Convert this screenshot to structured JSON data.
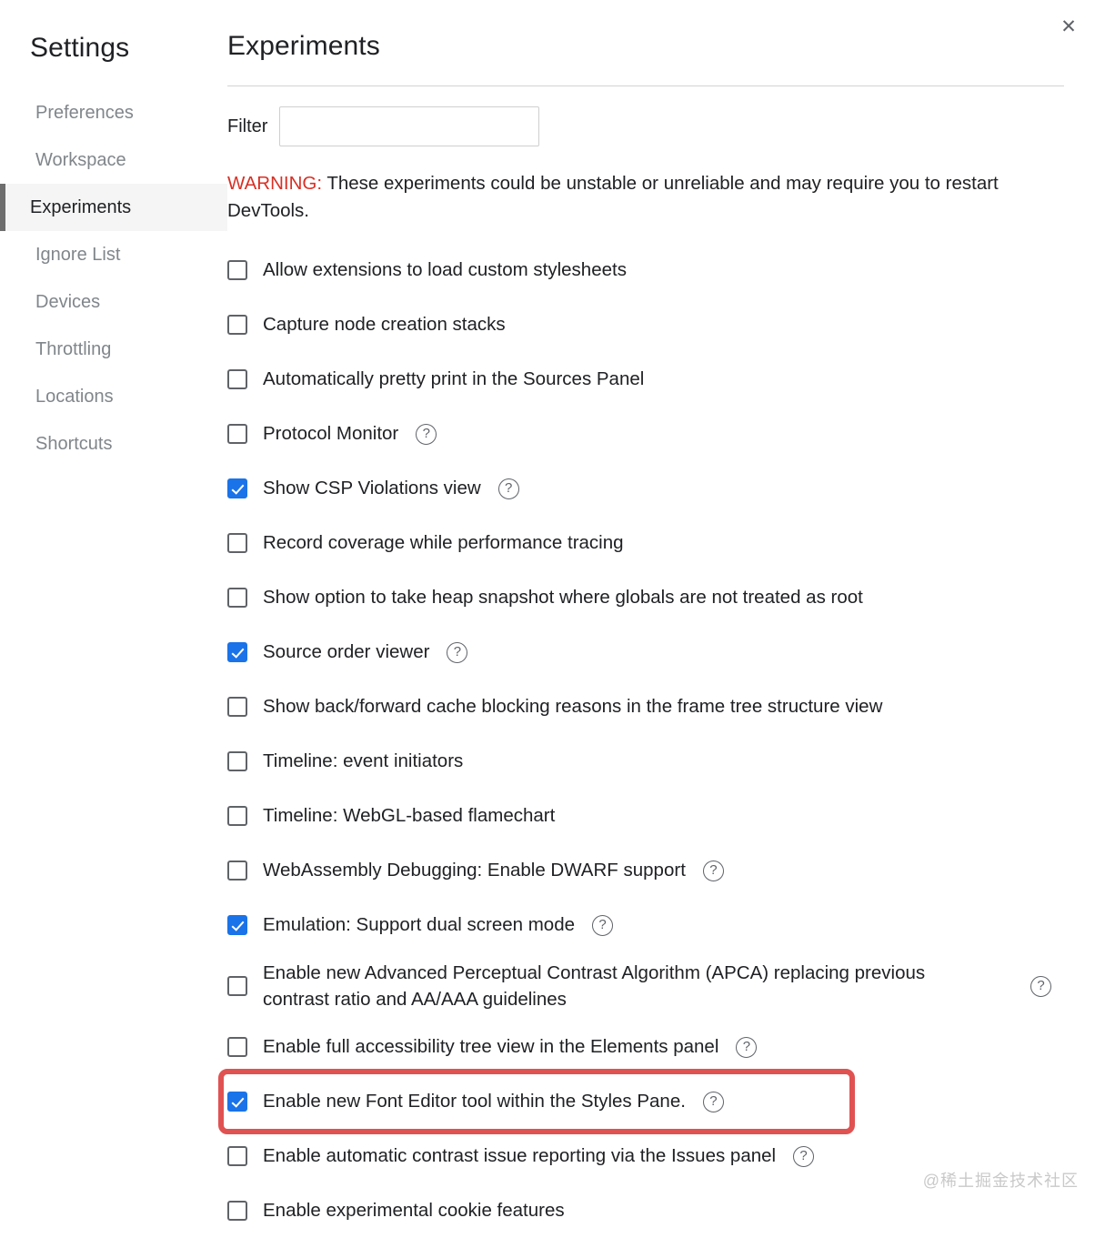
{
  "window": {
    "close_icon": "close-icon",
    "close_label": "✕"
  },
  "sidebar": {
    "title": "Settings",
    "items": [
      {
        "label": "Preferences",
        "selected": false
      },
      {
        "label": "Workspace",
        "selected": false
      },
      {
        "label": "Experiments",
        "selected": true
      },
      {
        "label": "Ignore List",
        "selected": false
      },
      {
        "label": "Devices",
        "selected": false
      },
      {
        "label": "Throttling",
        "selected": false
      },
      {
        "label": "Locations",
        "selected": false
      },
      {
        "label": "Shortcuts",
        "selected": false
      }
    ]
  },
  "main": {
    "title": "Experiments",
    "filter": {
      "label": "Filter",
      "value": "",
      "placeholder": ""
    },
    "warning": {
      "prefix": "WARNING:",
      "text": " These experiments could be unstable or unreliable and may require you to restart DevTools.",
      "prefix_color": "#d93025"
    },
    "experiments": [
      {
        "label": "Allow extensions to load custom stylesheets",
        "checked": false,
        "help": false,
        "help_far": false
      },
      {
        "label": "Capture node creation stacks",
        "checked": false,
        "help": false,
        "help_far": false
      },
      {
        "label": "Automatically pretty print in the Sources Panel",
        "checked": false,
        "help": false,
        "help_far": false
      },
      {
        "label": "Protocol Monitor",
        "checked": false,
        "help": true,
        "help_far": false
      },
      {
        "label": "Show CSP Violations view",
        "checked": true,
        "help": true,
        "help_far": false
      },
      {
        "label": "Record coverage while performance tracing",
        "checked": false,
        "help": false,
        "help_far": false
      },
      {
        "label": "Show option to take heap snapshot where globals are not treated as root",
        "checked": false,
        "help": false,
        "help_far": false
      },
      {
        "label": "Source order viewer",
        "checked": true,
        "help": true,
        "help_far": false
      },
      {
        "label": "Show back/forward cache blocking reasons in the frame tree structure view",
        "checked": false,
        "help": false,
        "help_far": false
      },
      {
        "label": "Timeline: event initiators",
        "checked": false,
        "help": false,
        "help_far": false
      },
      {
        "label": "Timeline: WebGL-based flamechart",
        "checked": false,
        "help": false,
        "help_far": false
      },
      {
        "label": "WebAssembly Debugging: Enable DWARF support",
        "checked": false,
        "help": true,
        "help_far": false
      },
      {
        "label": "Emulation: Support dual screen mode",
        "checked": true,
        "help": true,
        "help_far": false
      },
      {
        "label": "Enable new Advanced Perceptual Contrast Algorithm (APCA) replacing previous contrast ratio and AA/AAA guidelines",
        "checked": false,
        "help": true,
        "help_far": true,
        "two_line": true
      },
      {
        "label": "Enable full accessibility tree view in the Elements panel",
        "checked": false,
        "help": true,
        "help_far": false
      },
      {
        "label": "Enable new Font Editor tool within the Styles Pane.",
        "checked": true,
        "help": true,
        "help_far": false,
        "highlighted": true
      },
      {
        "label": "Enable automatic contrast issue reporting via the Issues panel",
        "checked": false,
        "help": true,
        "help_far": false
      },
      {
        "label": "Enable experimental cookie features",
        "checked": false,
        "help": false,
        "help_far": false
      }
    ],
    "help_glyph": "?"
  },
  "annotation": {
    "highlight_color": "#e05252"
  },
  "watermark": {
    "text": "@稀土掘金技术社区"
  }
}
